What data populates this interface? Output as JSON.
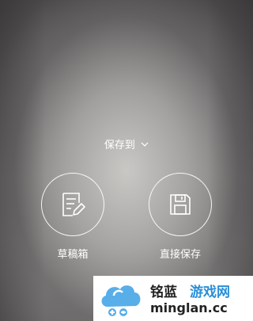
{
  "save_menu": {
    "title": "保存到",
    "options": [
      {
        "label": "草稿箱",
        "icon": "draft-edit-icon"
      },
      {
        "label": "直接保存",
        "icon": "floppy-disk-icon"
      }
    ]
  },
  "watermark": {
    "brand_part1": "铭蓝",
    "brand_part2": "游戏网",
    "url": "minglan.cc",
    "logo_icon": "cloud-logo-icon",
    "brand_color": "#2a8fd8"
  }
}
